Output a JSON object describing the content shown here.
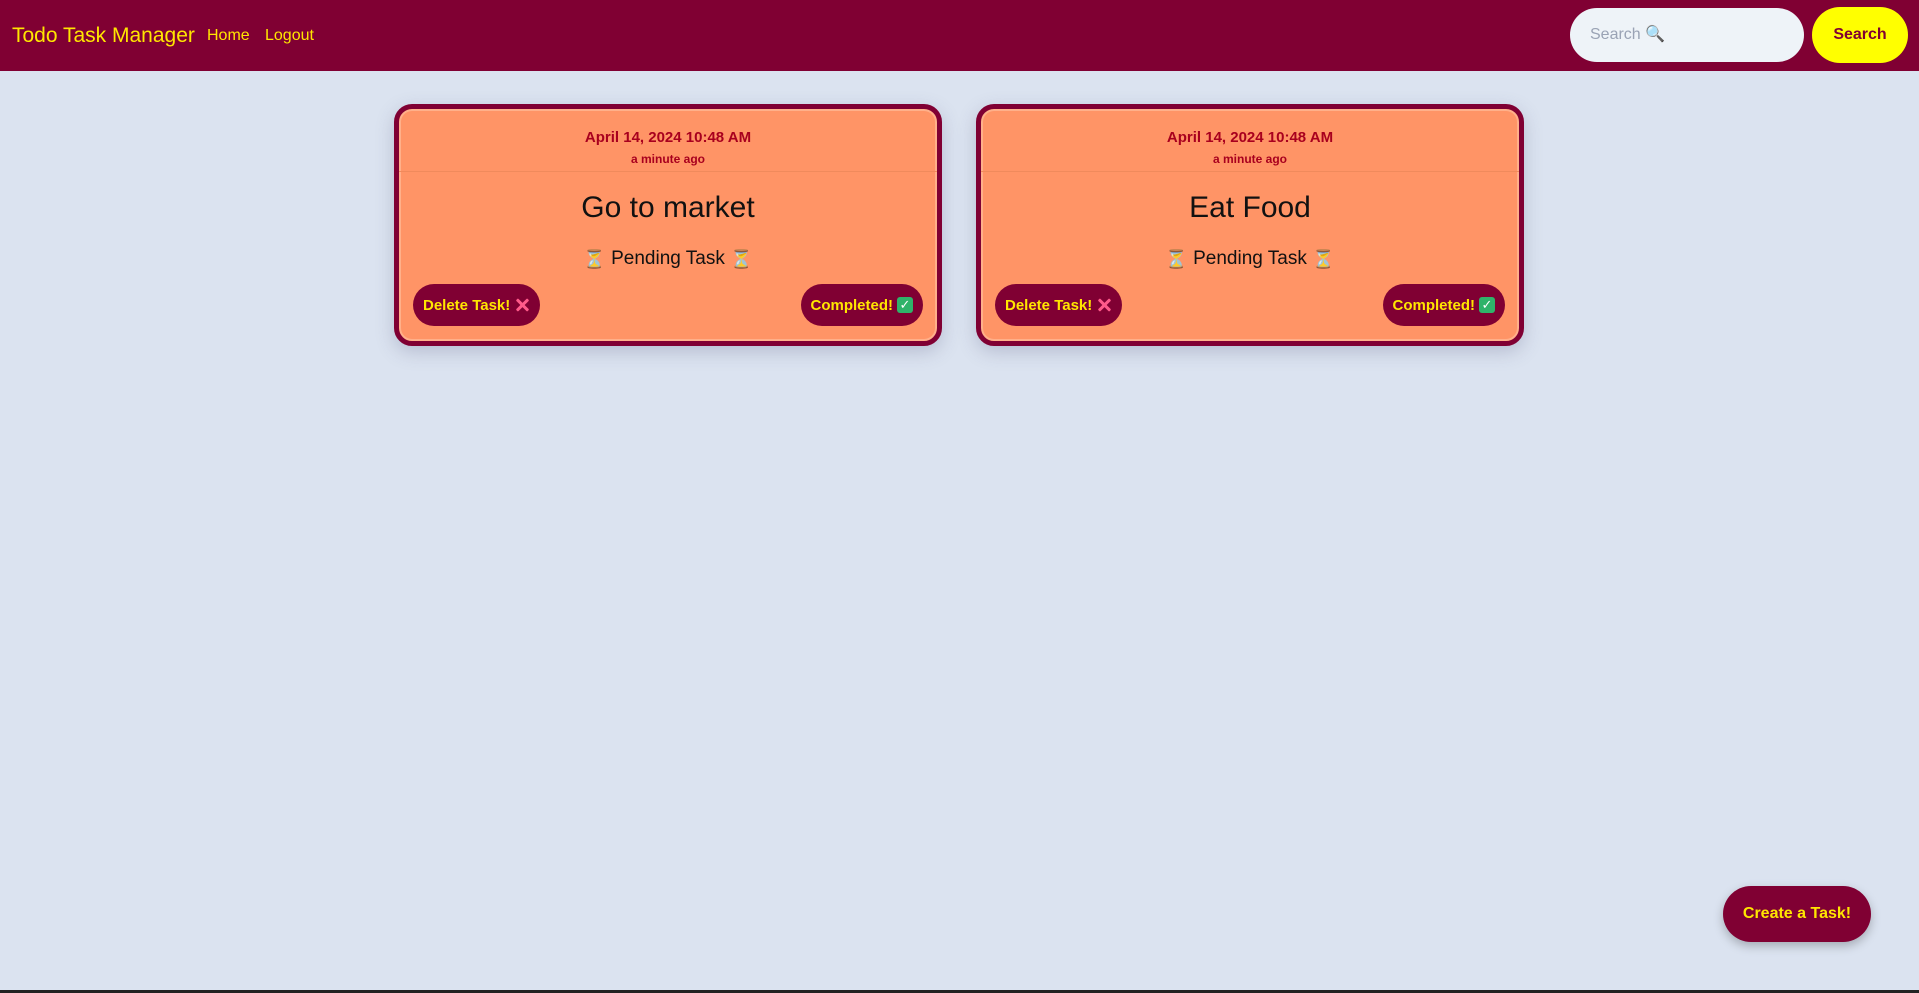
{
  "header": {
    "brand": "Todo Task Manager",
    "nav": {
      "home": "Home",
      "logout": "Logout"
    },
    "search": {
      "placeholder": "Search 🔍",
      "button_label": "Search"
    }
  },
  "tasks": [
    {
      "date": "April 14, 2024 10:48 AM",
      "relative_time": "a minute ago",
      "title": "Go to market",
      "status": "Pending Task",
      "delete_label": "Delete Task!",
      "complete_label": "Completed!"
    },
    {
      "date": "April 14, 2024 10:48 AM",
      "relative_time": "a minute ago",
      "title": "Eat Food",
      "status": "Pending Task",
      "delete_label": "Delete Task!",
      "complete_label": "Completed!"
    }
  ],
  "fab": {
    "label": "Create a Task!"
  },
  "icons": {
    "status": "hourglass-icon",
    "delete": "x-icon",
    "complete": "check-icon",
    "search": "magnifier-icon"
  },
  "colors": {
    "navbar": "#800033",
    "accent_text": "#ffe600",
    "search_button": "#ffff00",
    "card_background": "#ff9466",
    "page_background": "#dbe3f0"
  }
}
